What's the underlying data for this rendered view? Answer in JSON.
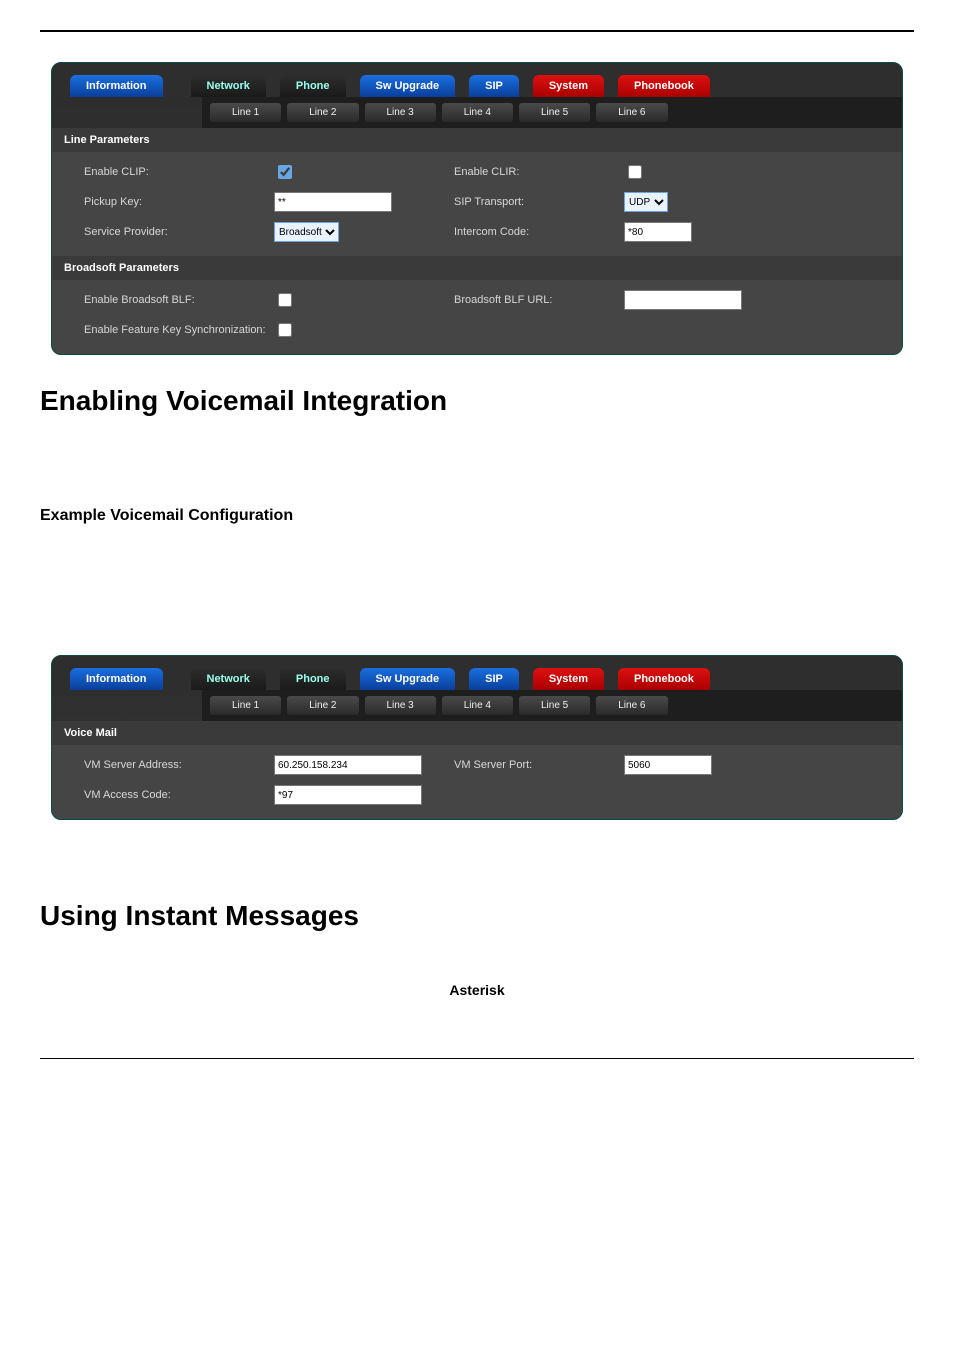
{
  "nav": {
    "information": "Information",
    "network": "Network",
    "phone": "Phone",
    "swupgrade": "Sw Upgrade",
    "sip": "SIP",
    "system": "System",
    "phonebook": "Phonebook"
  },
  "subtabs": [
    "Line 1",
    "Line 2",
    "Line 3",
    "Line 4",
    "Line 5",
    "Line 6"
  ],
  "panel1": {
    "lineParamsTitle": "Line Parameters",
    "broadsoftParamsTitle": "Broadsoft Parameters",
    "labels": {
      "enableClip": "Enable CLIP:",
      "enableClir": "Enable CLIR:",
      "pickupKey": "Pickup Key:",
      "sipTransport": "SIP Transport:",
      "serviceProvider": "Service Provider:",
      "intercomCode": "Intercom Code:",
      "enableBroadsoftBlf": "Enable Broadsoft BLF:",
      "broadsoftBlfUrl": "Broadsoft BLF URL:",
      "enableFKS": "Enable Feature Key Synchronization:"
    },
    "values": {
      "enableClip": true,
      "enableClir": false,
      "pickupKey": "**",
      "sipTransport": "UDP",
      "serviceProvider": "Broadsoft",
      "intercomCode": "*80",
      "enableBroadsoftBlf": false,
      "broadsoftBlfUrl": "",
      "enableFKS": false
    }
  },
  "heading1": "Enabling Voicemail Integration",
  "heading2": "Example Voicemail Configuration",
  "heading3": "Using Instant Messages",
  "asterisk": "Asterisk",
  "panel2": {
    "voiceMailTitle": "Voice Mail",
    "labels": {
      "vmserveraddr": "VM Server Address:",
      "vmserverport": "VM Server Port:",
      "vmaccesscode": "VM Access Code:"
    },
    "values": {
      "vmserveraddr": "60.250.158.234",
      "vmserverport": "5060",
      "vmaccesscode": "*97"
    }
  }
}
